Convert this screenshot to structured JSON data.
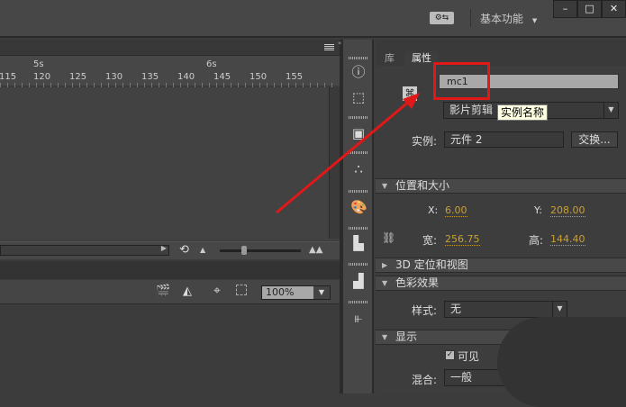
{
  "titlebar": {
    "workspace_label": "基本功能",
    "workspace_icon": "gear-swap-icon",
    "min": "–",
    "max": "□",
    "close": "✕"
  },
  "timeline": {
    "seconds": [
      "5s",
      "6s"
    ],
    "frames": [
      "115",
      "120",
      "125",
      "130",
      "135",
      "140",
      "145",
      "150",
      "155"
    ],
    "menu_icon": "panel-menu-icon"
  },
  "stage_toolbar": {
    "zoom_value": "100%"
  },
  "properties": {
    "tabs": [
      "库",
      "属性"
    ],
    "active_tab": "属性",
    "instance_name": "mc1",
    "symbol_type": "影片剪辑",
    "tooltip": "实例名称",
    "instance_label": "实例:",
    "instance_value": "元件 2",
    "swap_button": "交换...",
    "sections": {
      "position": "位置和大小",
      "threed": "3D 定位和视图",
      "color": "色彩效果",
      "display": "显示"
    },
    "x_label": "X:",
    "x_value": "6.00",
    "y_label": "Y:",
    "y_value": "208.00",
    "w_label": "宽:",
    "w_value": "256.75",
    "h_label": "高:",
    "h_value": "144.40",
    "style_label": "样式:",
    "style_value": "无",
    "visible_label": "可见",
    "visible_checked": true,
    "blend_label": "混合:",
    "blend_value": "一般"
  },
  "colors": {
    "highlight": "#e01818",
    "value": "#c8a032"
  }
}
